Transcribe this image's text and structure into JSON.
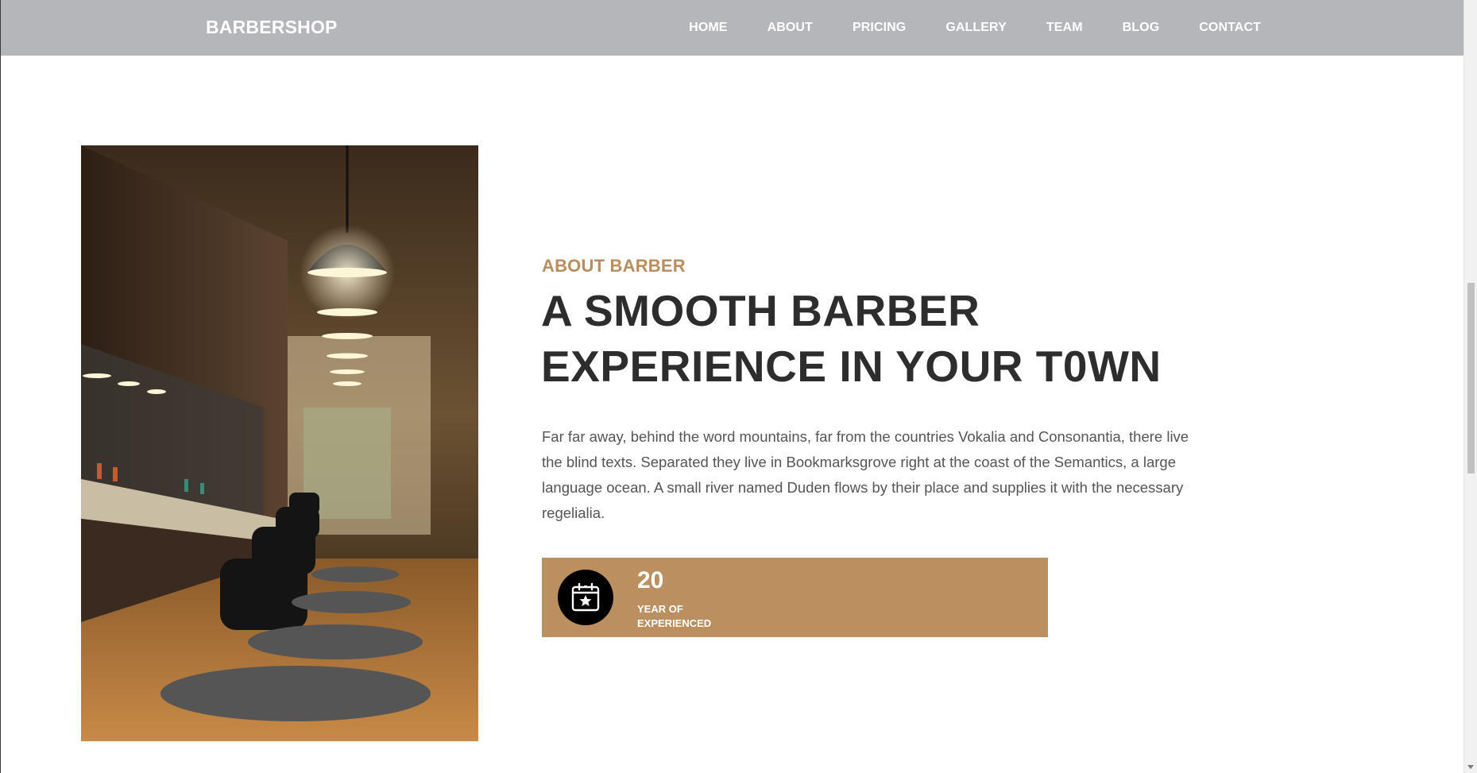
{
  "navbar": {
    "brand": "BARBERSHOP",
    "items": [
      {
        "label": "HOME"
      },
      {
        "label": "ABOUT"
      },
      {
        "label": "PRICING"
      },
      {
        "label": "GALLERY"
      },
      {
        "label": "TEAM"
      },
      {
        "label": "BLOG"
      },
      {
        "label": "CONTACT"
      }
    ],
    "background": "#b5b6b9"
  },
  "about": {
    "subheading": "ABOUT BARBER",
    "heading_line1": "A SMOOTH BARBER",
    "heading_line2": "EXPERIENCE IN YOUR T0WN",
    "description": "Far far away, behind the word mountains, far from the countries Vokalia and Consonantia, there live the blind texts. Separated they live in Bookmarksgrove right at the coast of the Semantics, a large language ocean. A small river named Duden flows by their place and supplies it with the necessary regelialia.",
    "image_alt": "barbershop-interior-photo"
  },
  "experience": {
    "number": "20",
    "label": "YEAR OF EXPERIENCED",
    "icon": "calendar-star-icon"
  },
  "colors": {
    "accent": "#bb8f60",
    "heading": "#2d2d2d",
    "text": "#555555",
    "icon_circle": "#000000"
  }
}
